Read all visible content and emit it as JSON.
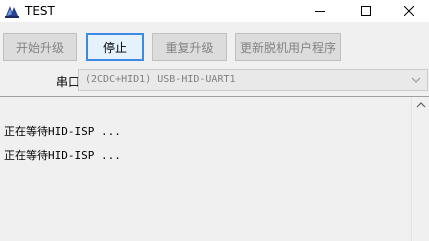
{
  "window": {
    "title": "TEST",
    "icon": "app-logo-icon"
  },
  "toolbar": {
    "start_upgrade": "开始升级",
    "stop": "停止",
    "repeat_upgrade": "重复升级",
    "update_program": "更新脱机用户程序"
  },
  "port": {
    "label": "串口",
    "selected": "(2CDC+HID1) USB-HID-UART1"
  },
  "log": {
    "lines": [
      "正在等待HID-ISP ...",
      "正在等待HID-ISP ..."
    ]
  },
  "colors": {
    "focus_border": "#3c8ae1",
    "disabled_text": "#838383"
  }
}
